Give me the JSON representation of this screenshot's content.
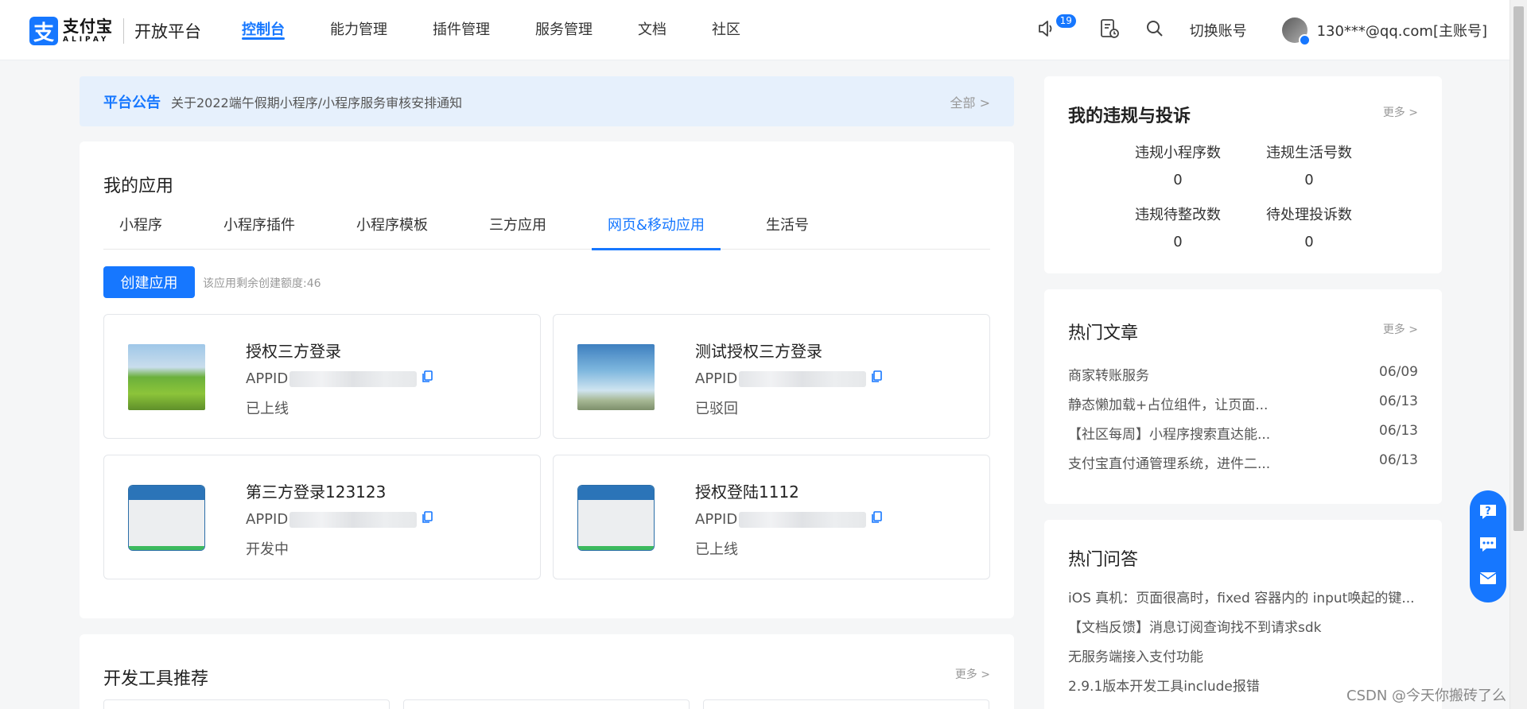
{
  "header": {
    "logo_mark": "支",
    "logo_cn": "支付宝",
    "logo_en": "ALIPAY",
    "platform": "开放平台",
    "nav": [
      {
        "label": "控制台",
        "active": true
      },
      {
        "label": "能力管理",
        "active": false
      },
      {
        "label": "插件管理",
        "active": false
      },
      {
        "label": "服务管理",
        "active": false
      },
      {
        "label": "文档",
        "active": false
      },
      {
        "label": "社区",
        "active": false
      }
    ],
    "notice_count": "19",
    "switch_account": "切换账号",
    "account": "130***@qq.com[主账号]"
  },
  "notice": {
    "label": "平台公告",
    "text": "关于2022端午假期小程序/小程序服务审核安排通知",
    "all": "全部 >"
  },
  "apps": {
    "title": "我的应用",
    "tabs": [
      "小程序",
      "小程序插件",
      "小程序模板",
      "三方应用",
      "网页&移动应用",
      "生活号"
    ],
    "active_tab": "网页&移动应用",
    "create_button": "创建应用",
    "quota": "该应用剩余创建额度:46",
    "items": [
      {
        "name": "授权三方登录",
        "appid_label": "APPID",
        "status": "已上线"
      },
      {
        "name": "测试授权三方登录",
        "appid_label": "APPID",
        "status": "已驳回"
      },
      {
        "name": "第三方登录123123",
        "appid_label": "APPID",
        "status": "开发中"
      },
      {
        "name": "授权登陆1112",
        "appid_label": "APPID",
        "status": "已上线"
      }
    ]
  },
  "dev_tools": {
    "title": "开发工具推荐",
    "more": "更多 >"
  },
  "violations": {
    "title": "我的违规与投诉",
    "more": "更多 >",
    "stats": [
      {
        "label": "违规小程序数",
        "value": "0"
      },
      {
        "label": "违规生活号数",
        "value": "0"
      },
      {
        "label": "违规待整改数",
        "value": "0"
      },
      {
        "label": "待处理投诉数",
        "value": "0"
      }
    ]
  },
  "articles": {
    "title": "热门文章",
    "more": "更多 >",
    "items": [
      {
        "title": "商家转账服务",
        "date": "06/09"
      },
      {
        "title": "静态懒加载+占位组件，让页面...",
        "date": "06/13"
      },
      {
        "title": "【社区每周】小程序搜索直达能...",
        "date": "06/13"
      },
      {
        "title": "支付宝直付通管理系统，进件二...",
        "date": "06/13"
      }
    ]
  },
  "faq": {
    "title": "热门问答",
    "items": [
      "iOS 真机：页面很高时，fixed 容器内的 input唤起的键...",
      "【文档反馈】消息订阅查询找不到请求sdk",
      "无服务端接入支付功能",
      "2.9.1版本开发工具include报错"
    ]
  },
  "watermark": "CSDN @今天你搬砖了么",
  "colors": {
    "accent": "#1677ff",
    "notice_bg": "#e6f0fc",
    "page_bg": "#f5f6f7"
  }
}
